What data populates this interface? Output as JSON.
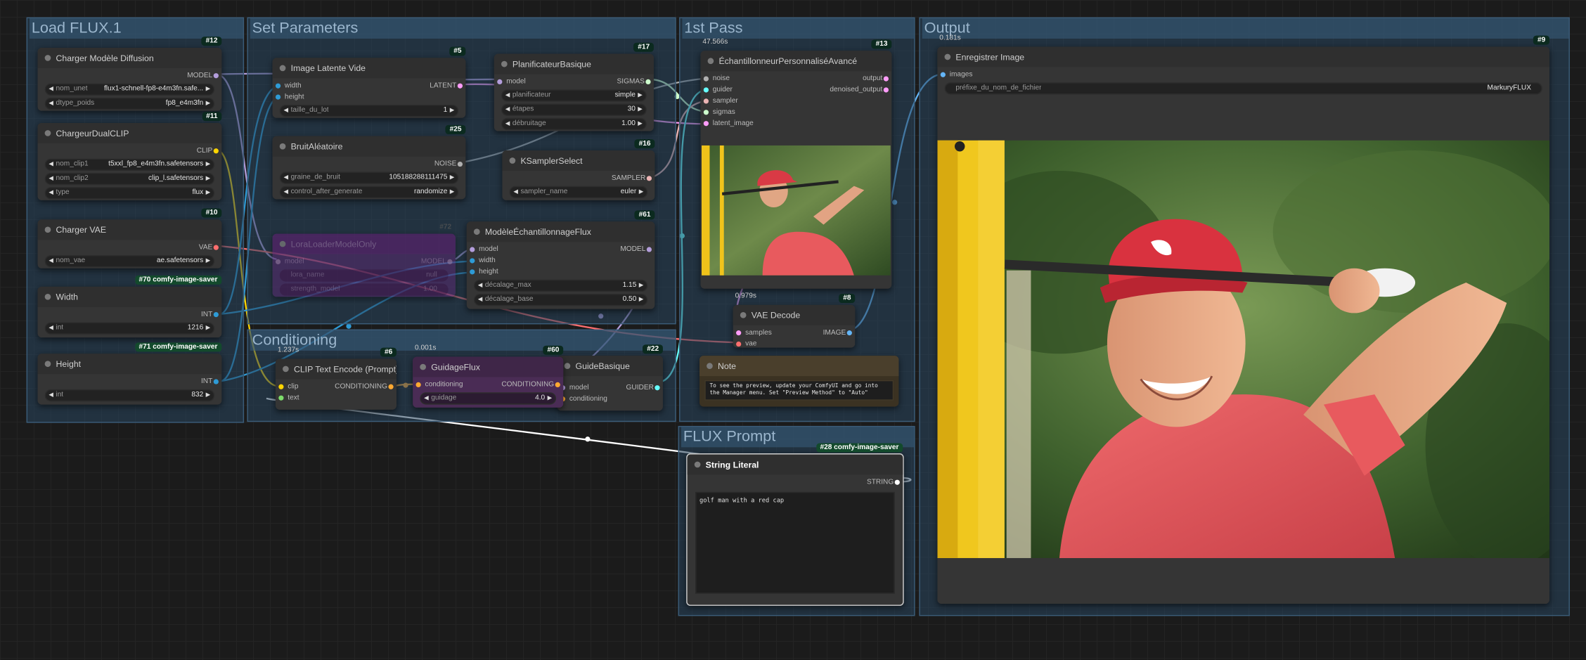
{
  "groups": {
    "load_flux": "Load FLUX.1",
    "set_params": "Set Parameters",
    "first_pass": "1st Pass",
    "output": "Output",
    "conditioning": "Conditioning",
    "flux_prompt": "FLUX Prompt"
  },
  "nodes": {
    "charger_modele": {
      "title": "Charger Modèle Diffusion",
      "id": "#12",
      "out": "MODEL",
      "unet_label": "nom_unet",
      "unet_value": "flux1-schnell-fp8-e4m3fn.safe...",
      "dtype_label": "dtype_poids",
      "dtype_value": "fp8_e4m3fn"
    },
    "dualclip": {
      "title": "ChargeurDualCLIP",
      "id": "#11",
      "out": "CLIP",
      "clip1_label": "nom_clip1",
      "clip1_value": "t5xxl_fp8_e4m3fn.safetensors",
      "clip2_label": "nom_clip2",
      "clip2_value": "clip_l.safetensors",
      "type_label": "type",
      "type_value": "flux"
    },
    "vae_loader": {
      "title": "Charger VAE",
      "id": "#10",
      "out": "VAE",
      "vae_label": "nom_vae",
      "vae_value": "ae.safetensors"
    },
    "width": {
      "title": "Width",
      "id": "#70 comfy-image-saver",
      "out": "INT",
      "int_label": "int",
      "int_value": "1216"
    },
    "height": {
      "title": "Height",
      "id": "#71 comfy-image-saver",
      "out": "INT",
      "int_label": "int",
      "int_value": "832"
    },
    "latent": {
      "title": "Image Latente Vide",
      "id": "#5",
      "in1": "width",
      "in2": "height",
      "out": "LATENT",
      "batch_label": "taille_du_lot",
      "batch_value": "1"
    },
    "noise": {
      "title": "BruitAléatoire",
      "id": "#25",
      "out": "NOISE",
      "seed_label": "graine_de_bruit",
      "seed_value": "105188288111475",
      "cag_label": "control_after_generate",
      "cag_value": "randomize"
    },
    "scheduler": {
      "title": "PlanificateurBasique",
      "id": "#17",
      "in": "model",
      "out": "SIGMAS",
      "sched_label": "planificateur",
      "sched_value": "simple",
      "steps_label": "étapes",
      "steps_value": "30",
      "denoise_label": "débruitage",
      "denoise_value": "1.00"
    },
    "ksampler_select": {
      "title": "KSamplerSelect",
      "id": "#16",
      "out": "SAMPLER",
      "sampler_label": "sampler_name",
      "sampler_value": "euler"
    },
    "lora": {
      "title": "LoraLoaderModelOnly",
      "id": "#72",
      "in": "model",
      "out": "MODEL",
      "name_label": "lora_name",
      "name_value": "null",
      "strength_label": "strength_model",
      "strength_value": "1.00"
    },
    "model_sampling": {
      "title": "ModèleÉchantillonnageFlux",
      "id": "#61",
      "in1": "model",
      "in2": "width",
      "in3": "height",
      "out": "MODEL",
      "max_label": "décalage_max",
      "max_value": "1.15",
      "base_label": "décalage_base",
      "base_value": "0.50"
    },
    "sampler_adv": {
      "title": "ÉchantillonneurPersonnaliséAvancé",
      "id": "#13",
      "timing": "47.566s",
      "in1": "noise",
      "in2": "guider",
      "in3": "sampler",
      "in4": "sigmas",
      "in5": "latent_image",
      "out1": "output",
      "out2": "denoised_output"
    },
    "vae_decode": {
      "title": "VAE Decode",
      "id": "#8",
      "timing": "0.979s",
      "in1": "samples",
      "in2": "vae",
      "out": "IMAGE"
    },
    "save_image": {
      "title": "Enregistrer Image",
      "id": "#9",
      "timing": "0.181s",
      "in": "images",
      "prefix_label": "préfixe_du_nom_de_fichier",
      "prefix_value": "MarkuryFLUX"
    },
    "clip_encode": {
      "title": "CLIP Text Encode (Prompt)",
      "id": "#6",
      "timing": "1.237s",
      "in1": "clip",
      "in2": "text",
      "out": "CONDITIONING"
    },
    "flux_guidance": {
      "title": "GuidageFlux",
      "id": "#60",
      "timing": "0.001s",
      "in": "conditioning",
      "out": "CONDITIONING",
      "guid_label": "guidage",
      "guid_value": "4.0"
    },
    "basic_guider": {
      "title": "GuideBasique",
      "id": "#22",
      "in1": "model",
      "in2": "conditioning",
      "out": "GUIDER"
    },
    "note": {
      "title": "Note",
      "text": "To see the preview, update your ComfyUI and go into the Manager menu. Set \"Preview Method\" to \"Auto\""
    },
    "string_literal": {
      "title": "String Literal",
      "id": "#28 comfy-image-saver",
      "out": "STRING",
      "text": "golf man with a red cap"
    }
  },
  "colors": {
    "model": "#b39ddb",
    "clip": "#ffd500",
    "vae": "#ff6e6e",
    "int": "#2e9bd6",
    "latent": "#ff9cf9",
    "noise": "#b0b0b0",
    "sigmas": "#cdffcd",
    "sampler": "#ecb4b4",
    "conditioning": "#ffa931",
    "guider": "#66ffff",
    "image": "#64b5f6",
    "string": "#ffffff"
  }
}
